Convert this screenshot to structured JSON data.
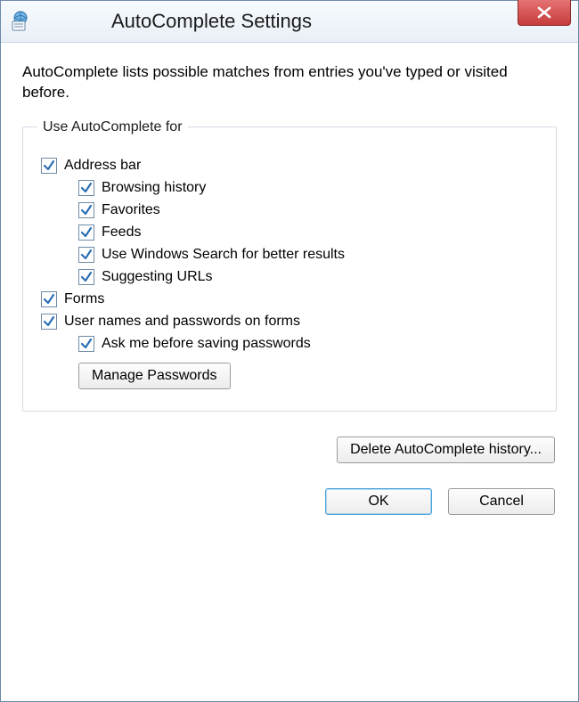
{
  "window": {
    "title": "AutoComplete Settings"
  },
  "intro": "AutoComplete lists possible matches from entries you've typed or visited before.",
  "group": {
    "legend": "Use AutoComplete for",
    "options": {
      "address_bar": {
        "label": "Address bar",
        "checked": true
      },
      "browsing_history": {
        "label": "Browsing history",
        "checked": true
      },
      "favorites": {
        "label": "Favorites",
        "checked": true
      },
      "feeds": {
        "label": "Feeds",
        "checked": true
      },
      "windows_search": {
        "label": "Use Windows Search for better results",
        "checked": true
      },
      "suggest_urls": {
        "label": "Suggesting URLs",
        "checked": true
      },
      "forms": {
        "label": "Forms",
        "checked": true
      },
      "userpass": {
        "label": "User names and passwords on forms",
        "checked": true
      },
      "ask_before_save": {
        "label": "Ask me before saving passwords",
        "checked": true
      }
    }
  },
  "buttons": {
    "manage_passwords": "Manage Passwords",
    "delete_history": "Delete AutoComplete history...",
    "ok": "OK",
    "cancel": "Cancel"
  }
}
